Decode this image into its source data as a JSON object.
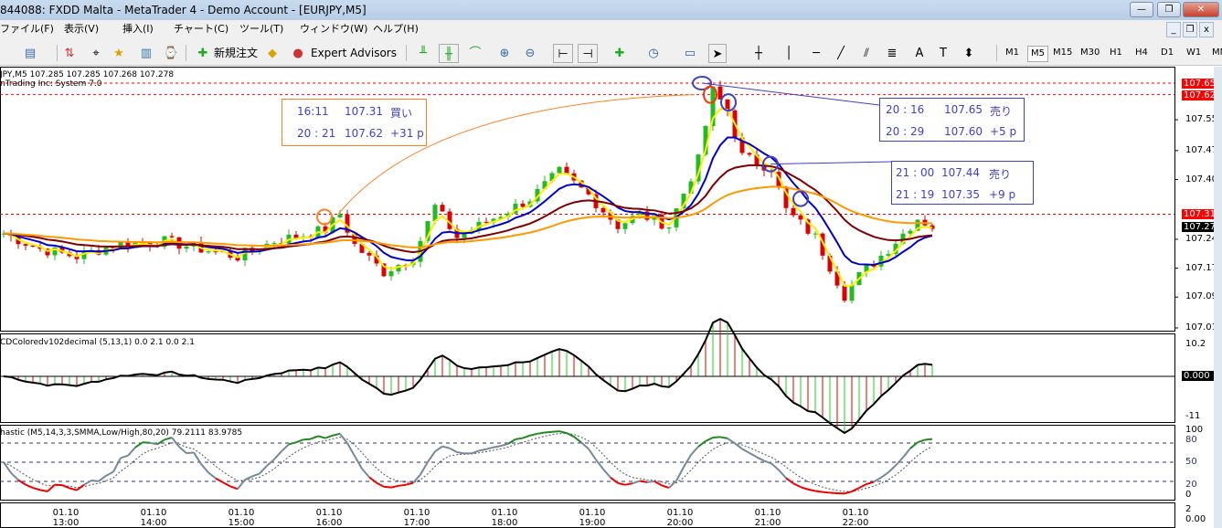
{
  "window": {
    "title": "844088: FXDD Malta - MetaTrader 4 - Demo Account - [EURJPY,M5]",
    "buttons": [
      "—",
      "❐",
      "✕"
    ]
  },
  "menu": [
    "ファイル(F)",
    "表示(V)",
    "挿入(I)",
    "チャート(C)",
    "ツール(T)",
    "ウィンドウ(W)",
    "ヘルプ(H)"
  ],
  "toolbar": {
    "new_order": "新規注文",
    "expert_advisors": "Expert Advisors",
    "timeframes": [
      "M1",
      "M5",
      "M15",
      "M30",
      "H1",
      "H4",
      "D1",
      "W1",
      "MN"
    ],
    "selected_timeframe": "M5"
  },
  "chart": {
    "header": "JPY,M5  107.285 107.285 107.268 107.278",
    "subheader": "nTrading Inc: System 7.0",
    "price_ticks": [
      "107.555",
      "107.475",
      "107.400",
      "107.245",
      "107.170",
      "107.095",
      "107.015"
    ],
    "price_tags": [
      {
        "label": "107.650",
        "color": "#ff0000",
        "price": 107.65
      },
      {
        "label": "107.620",
        "color": "#ff0000",
        "price": 107.62
      },
      {
        "label": "107.310",
        "color": "#ff0000",
        "price": 107.31
      },
      {
        "label": "107.278",
        "color": "#000000",
        "price": 107.278
      }
    ],
    "time_labels": [
      [
        "01.10",
        "13:00"
      ],
      [
        "01.10",
        "14:00"
      ],
      [
        "01.10",
        "15:00"
      ],
      [
        "01.10",
        "16:00"
      ],
      [
        "01.10",
        "17:00"
      ],
      [
        "01.10",
        "18:00"
      ],
      [
        "01.10",
        "19:00"
      ],
      [
        "01.10",
        "20:00"
      ],
      [
        "01.10",
        "21:00"
      ],
      [
        "01.10",
        "22:00"
      ]
    ],
    "keypoints": [
      [
        0,
        107.26
      ],
      [
        5,
        107.22
      ],
      [
        10,
        107.2
      ],
      [
        15,
        107.23
      ],
      [
        22,
        107.24
      ],
      [
        32,
        107.2
      ],
      [
        37,
        107.24
      ],
      [
        44,
        107.27
      ],
      [
        46,
        107.31
      ],
      [
        48,
        107.23
      ],
      [
        52,
        107.16
      ],
      [
        56,
        107.2
      ],
      [
        59,
        107.33
      ],
      [
        62,
        107.25
      ],
      [
        67,
        107.3
      ],
      [
        72,
        107.35
      ],
      [
        76,
        107.42
      ],
      [
        80,
        107.36
      ],
      [
        84,
        107.28
      ],
      [
        87,
        107.31
      ],
      [
        91,
        107.28
      ],
      [
        95,
        107.45
      ],
      [
        97,
        107.63
      ],
      [
        99,
        107.58
      ],
      [
        101,
        107.46
      ],
      [
        105,
        107.43
      ],
      [
        107,
        107.32
      ],
      [
        111,
        107.25
      ],
      [
        115,
        107.1
      ],
      [
        117,
        107.15
      ],
      [
        121,
        107.22
      ],
      [
        125,
        107.3
      ],
      [
        127,
        107.278
      ]
    ],
    "trades": [
      {
        "rows": [
          [
            "16:11",
            "107.31",
            "買い"
          ],
          [
            "20 : 21",
            "107.62",
            "+31 p"
          ]
        ],
        "color": "#ff8020"
      },
      {
        "rows": [
          [
            "20 : 16",
            "107.65",
            "売り"
          ],
          [
            "20 : 29",
            "107.60",
            "+5 p"
          ]
        ],
        "color": "#4040c0"
      },
      {
        "rows": [
          [
            "21 : 00",
            "107.44",
            "売り"
          ],
          [
            "21 : 19",
            "107.35",
            "+9 p"
          ]
        ],
        "color": "#4040c0"
      }
    ]
  },
  "macd": {
    "label": "CDColoredv102decimal (5,13,1) 0.0 2.1 0.0 2.1",
    "ticks": [
      "10.2",
      "-11"
    ],
    "value_tag": "0.000"
  },
  "stoch": {
    "label": "hastic (M5,14,3,3,SMMA,Low/High,80,20) 79.2111 83.9785",
    "ticks": [
      "100",
      "80",
      "50",
      "20",
      "0"
    ]
  },
  "bottom_ticks": [
    "2",
    "0.00"
  ]
}
